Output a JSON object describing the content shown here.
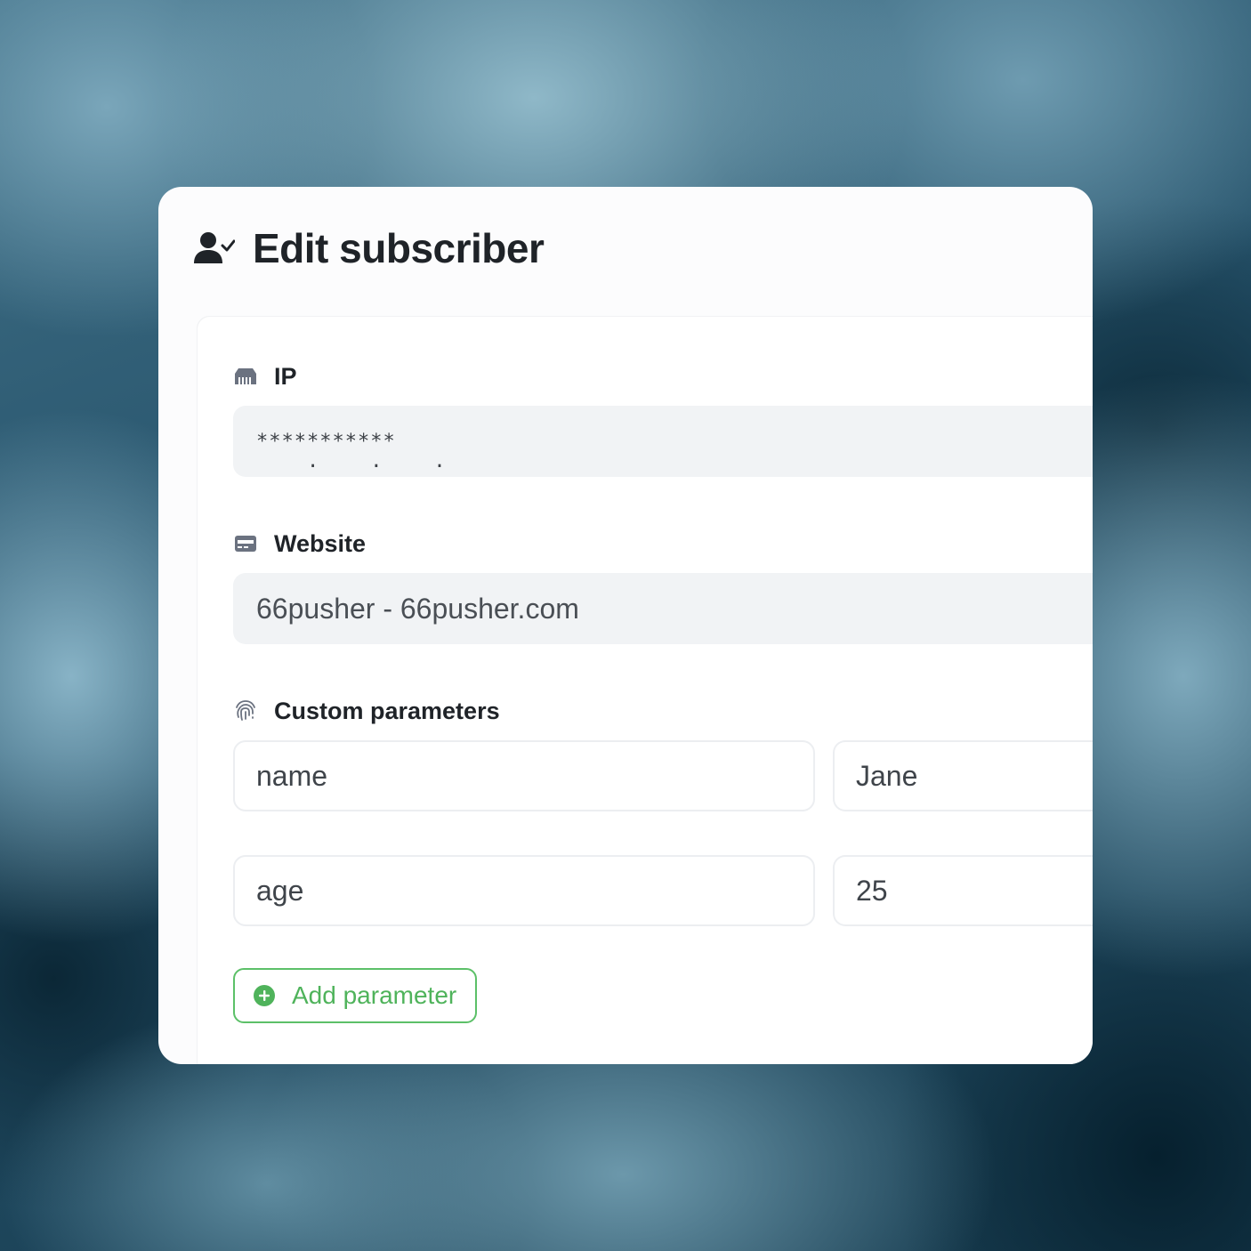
{
  "header": {
    "title": "Edit subscriber",
    "icon": "user-check-icon"
  },
  "fields": {
    "ip": {
      "label": "IP",
      "icon": "ethernet-icon",
      "value": "***********",
      "dots": "    .    .    ."
    },
    "website": {
      "label": "Website",
      "icon": "credit-card-icon",
      "value": "66pusher - 66pusher.com"
    },
    "custom": {
      "label": "Custom parameters",
      "icon": "fingerprint-icon",
      "params": [
        {
          "key": "name",
          "value": "Jane"
        },
        {
          "key": "age",
          "value": "25"
        }
      ]
    }
  },
  "actions": {
    "add_parameter_label": "Add parameter",
    "add_icon": "plus-circle-icon"
  },
  "colors": {
    "accent_green": "#4fb35b",
    "title": "#1f2328",
    "input_bg": "#f1f3f5"
  }
}
